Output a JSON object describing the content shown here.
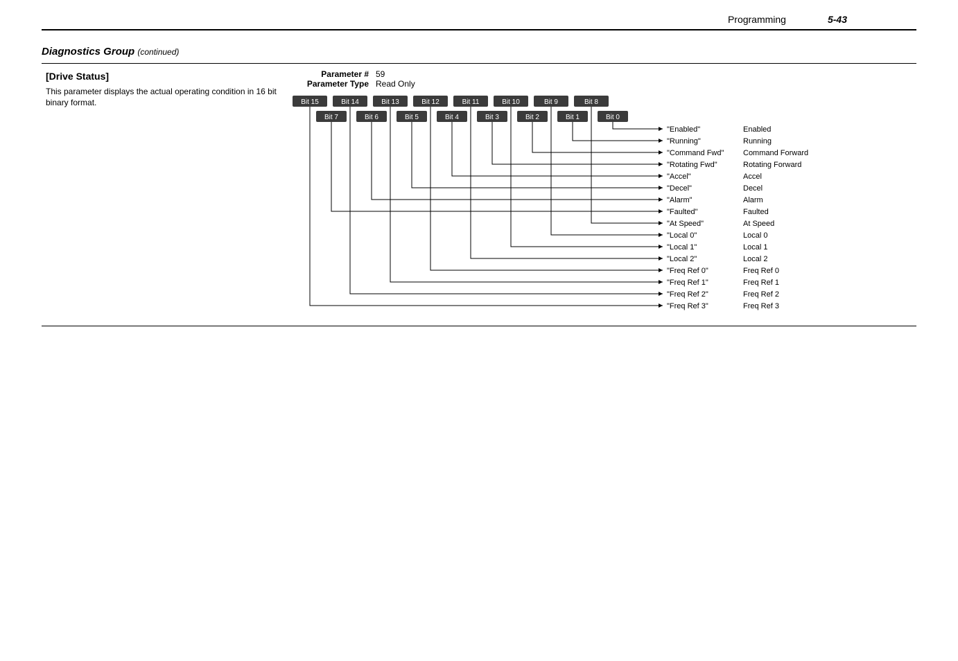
{
  "header": {
    "chapter": "Programming",
    "page": "5-43"
  },
  "group": {
    "title": "Diagnostics Group",
    "suffix": "(continued)"
  },
  "param": {
    "name": "[Drive Status]",
    "description": "This parameter displays the actual operating condition in 16 bit binary format.",
    "meta": {
      "number_label": "Parameter #",
      "number_value": "59",
      "type_label": "Parameter Type",
      "type_value": "Read Only"
    }
  },
  "top_bits": [
    "Bit 15",
    "Bit 14",
    "Bit 13",
    "Bit 12",
    "Bit 11",
    "Bit 10",
    "Bit 9",
    "Bit 8"
  ],
  "bottom_bits": [
    "Bit 7",
    "Bit 6",
    "Bit 5",
    "Bit 4",
    "Bit 3",
    "Bit 2",
    "Bit 1",
    "Bit 0"
  ],
  "rows": [
    {
      "label": "\"Enabled\"",
      "desc": "Enabled"
    },
    {
      "label": "\"Running\"",
      "desc": "Running"
    },
    {
      "label": "\"Command Fwd\"",
      "desc": "Command Forward"
    },
    {
      "label": "\"Rotating Fwd\"",
      "desc": "Rotating Forward"
    },
    {
      "label": "\"Accel\"",
      "desc": "Accel"
    },
    {
      "label": "\"Decel\"",
      "desc": "Decel"
    },
    {
      "label": "\"Alarm\"",
      "desc": "Alarm"
    },
    {
      "label": "\"Faulted\"",
      "desc": "Faulted"
    },
    {
      "label": "\"At Speed\"",
      "desc": "At Speed"
    },
    {
      "label": "\"Local 0\"",
      "desc": "Local 0"
    },
    {
      "label": "\"Local 1\"",
      "desc": "Local 1"
    },
    {
      "label": "\"Local 2\"",
      "desc": "Local 2"
    },
    {
      "label": "\"Freq Ref 0\"",
      "desc": "Freq Ref 0"
    },
    {
      "label": "\"Freq Ref 1\"",
      "desc": "Freq Ref 1"
    },
    {
      "label": "\"Freq Ref 2\"",
      "desc": "Freq Ref 2"
    },
    {
      "label": "\"Freq Ref 3\"",
      "desc": "Freq Ref 3"
    }
  ]
}
